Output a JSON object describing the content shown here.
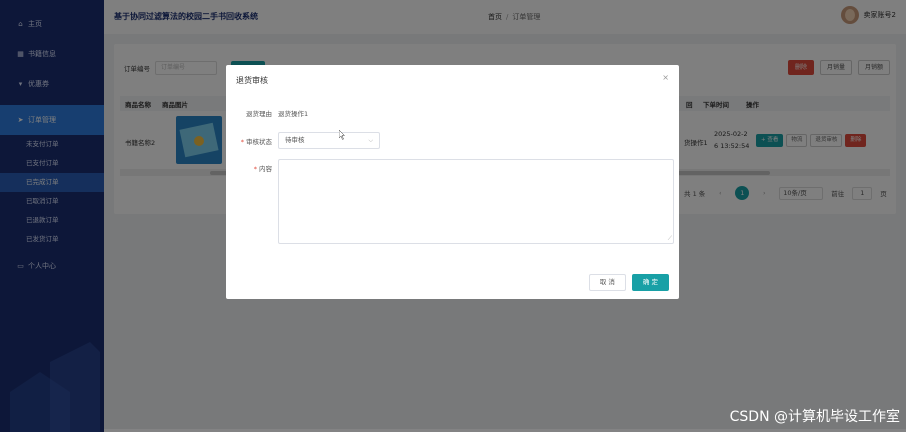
{
  "sidebar": {
    "items": [
      {
        "label": "主页",
        "icon": "home-icon"
      },
      {
        "label": "书籍信息",
        "icon": "grid-icon"
      },
      {
        "label": "优惠券",
        "icon": "ticket-icon"
      },
      {
        "label": "订单管理",
        "icon": "send-icon",
        "active": true
      },
      {
        "label": "个人中心",
        "icon": "user-card-icon"
      }
    ],
    "sub_items": [
      "未支付订单",
      "已支付订单",
      "已完成订单",
      "已取消订单",
      "已退款订单",
      "已发货订单"
    ],
    "active_sub": "已完成订单"
  },
  "header": {
    "title": "基于协同过滤算法的校园二手书回收系统",
    "breadcrumb_home": "首页",
    "breadcrumb_sep": "/",
    "breadcrumb_current": "订单管理",
    "username": "卖家账号2"
  },
  "main": {
    "search_label_1": "订单编号",
    "search_placeholder_1": "订单编号",
    "btn_delete": "删除",
    "btn_monthly_sales": "月销量",
    "btn_monthly_amount": "月销额",
    "columns": {
      "name": "商品名称",
      "image": "商品图片",
      "reason": "回",
      "time": "下单时间",
      "ops": "操作"
    },
    "row": {
      "name": "书籍名称2",
      "reason_value": "货操作1",
      "time_line1": "2025-02-2",
      "time_line2": "6 13:52:54",
      "op_view": "查看",
      "op_logistics": "物流",
      "op_return_review": "退货审核",
      "op_delete": "删除"
    },
    "pager": {
      "total": "共 1 条",
      "current": "1",
      "size": "10条/页",
      "goto_label": "前往",
      "goto_value": "1",
      "page_suffix": "页"
    }
  },
  "dialog": {
    "title": "退货审核",
    "close": "×",
    "reason_label": "退货理由",
    "reason_value": "退货操作1",
    "status_label": "审核状态",
    "status_value": "待审核",
    "content_label": "内容",
    "required_mark": "*",
    "cancel": "取 消",
    "confirm": "确 定"
  },
  "watermark": "CSDN @计算机毕设工作室",
  "colors": {
    "sidebar": "#1a2f72",
    "active": "#2e7de0",
    "accent": "#18a0a6",
    "danger": "#e04b3c"
  }
}
